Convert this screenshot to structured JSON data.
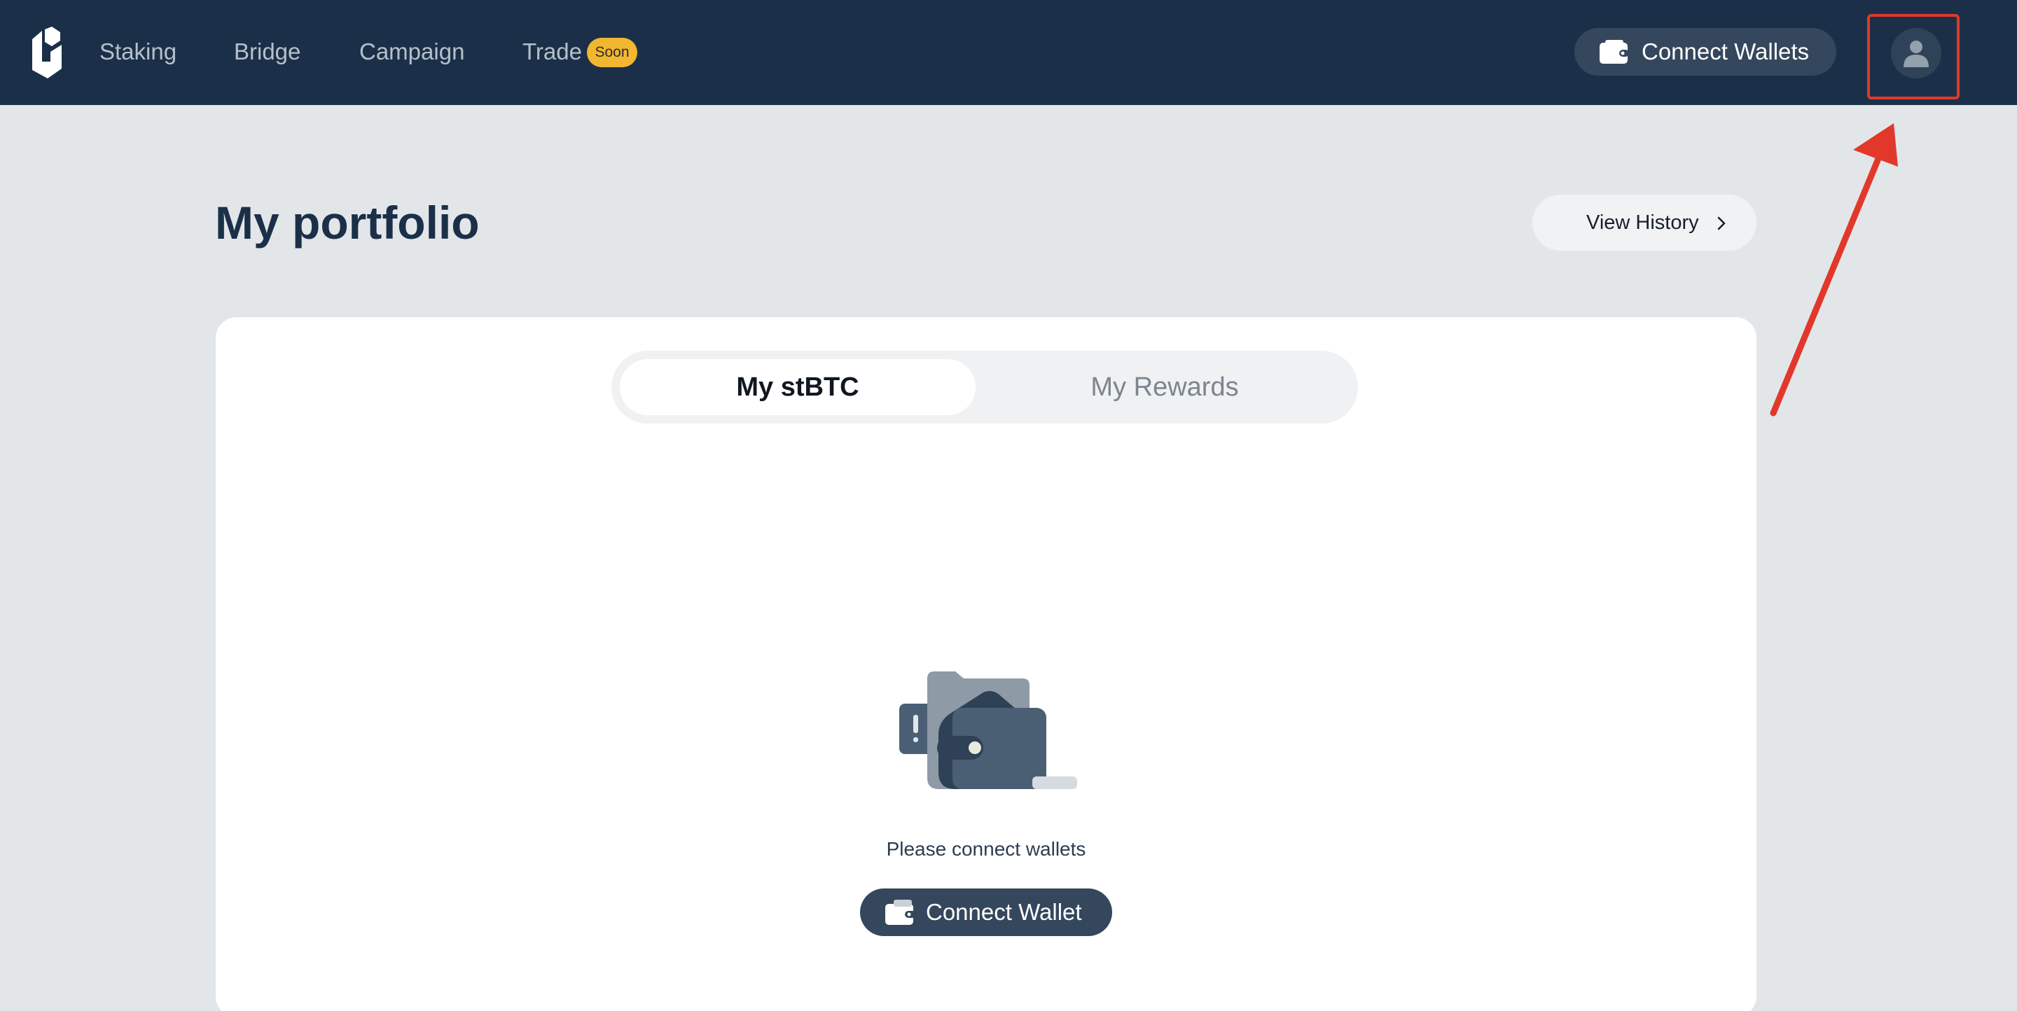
{
  "nav": {
    "items": [
      {
        "label": "Staking"
      },
      {
        "label": "Bridge"
      },
      {
        "label": "Campaign"
      },
      {
        "label": "Trade"
      }
    ],
    "trade_badge": "Soon",
    "connect_wallets_label": "Connect Wallets"
  },
  "page": {
    "title": "My portfolio",
    "view_history_label": "View History"
  },
  "tabs": [
    {
      "label": "My stBTC",
      "active": true
    },
    {
      "label": "My Rewards",
      "active": false
    }
  ],
  "empty_state": {
    "message": "Please connect wallets",
    "connect_wallet_label": "Connect Wallet"
  },
  "colors": {
    "nav_bg": "#1b3048",
    "page_bg": "#e3e6e9",
    "button_bg": "#34475c",
    "badge": "#f2b731",
    "annotation": "#e2382b"
  },
  "icons": [
    "logo-icon",
    "wallet-icon",
    "user-icon",
    "chevron-right-icon",
    "empty-wallet-illustration"
  ]
}
